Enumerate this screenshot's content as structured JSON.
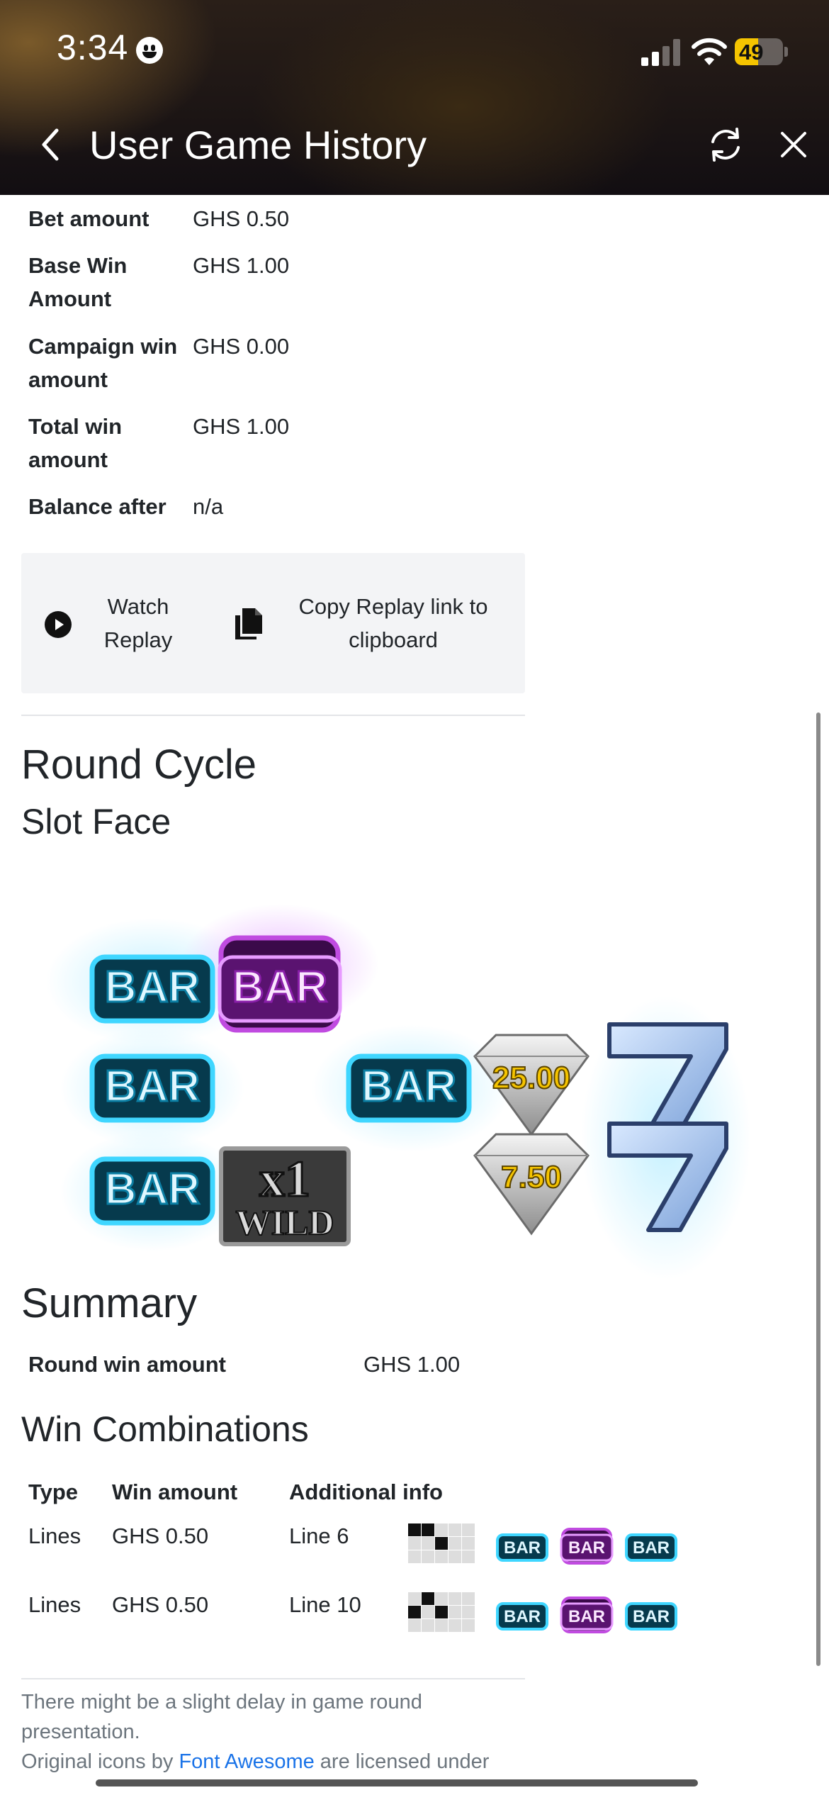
{
  "status_bar": {
    "time": "3:34",
    "battery": "49",
    "battery_level_percent": 49,
    "signal_bars_active": 2,
    "signal_bars_total": 4
  },
  "nav": {
    "title": "User Game History",
    "back_icon": "chevron-left-icon",
    "refresh_icon": "refresh-icon",
    "close_icon": "close-icon"
  },
  "details": [
    {
      "label": "Bet amount",
      "value": "GHS 0.50"
    },
    {
      "label": "Base Win Amount",
      "value": "GHS 1.00"
    },
    {
      "label": "Campaign win amount",
      "value": "GHS 0.00"
    },
    {
      "label": "Total win amount",
      "value": "GHS 1.00"
    },
    {
      "label": "Balance after",
      "value": "n/a"
    }
  ],
  "replay": {
    "watch_label": "Watch Replay",
    "copy_label": "Copy Replay link to clipboard"
  },
  "round_cycle": {
    "title": "Round Cycle",
    "slot_face_title": "Slot Face",
    "symbol_values": [
      "25.00",
      "7.50"
    ],
    "wild_text": "x1",
    "wild_label": "WILD",
    "bar_text": "BAR"
  },
  "summary": {
    "title": "Summary",
    "label": "Round win amount",
    "value": "GHS 1.00"
  },
  "win_combinations": {
    "title": "Win Combinations",
    "headers": [
      "Type",
      "Win amount",
      "Additional info"
    ],
    "rows": [
      {
        "type": "Lines",
        "amount": "GHS 0.50",
        "info": "Line 6"
      },
      {
        "type": "Lines",
        "amount": "GHS 0.50",
        "info": "Line 10"
      }
    ]
  },
  "footer": {
    "note": "There might be a slight delay in game round presentation.",
    "icons_prefix": "Original icons by ",
    "icons_link": "Font Awesome",
    "icons_suffix": " are licensed under"
  },
  "colors": {
    "bar_cyan": "#3fd6ff",
    "bar_purple": "#c04be0",
    "gold_text": "#f5c400",
    "link": "#1a73e8"
  }
}
